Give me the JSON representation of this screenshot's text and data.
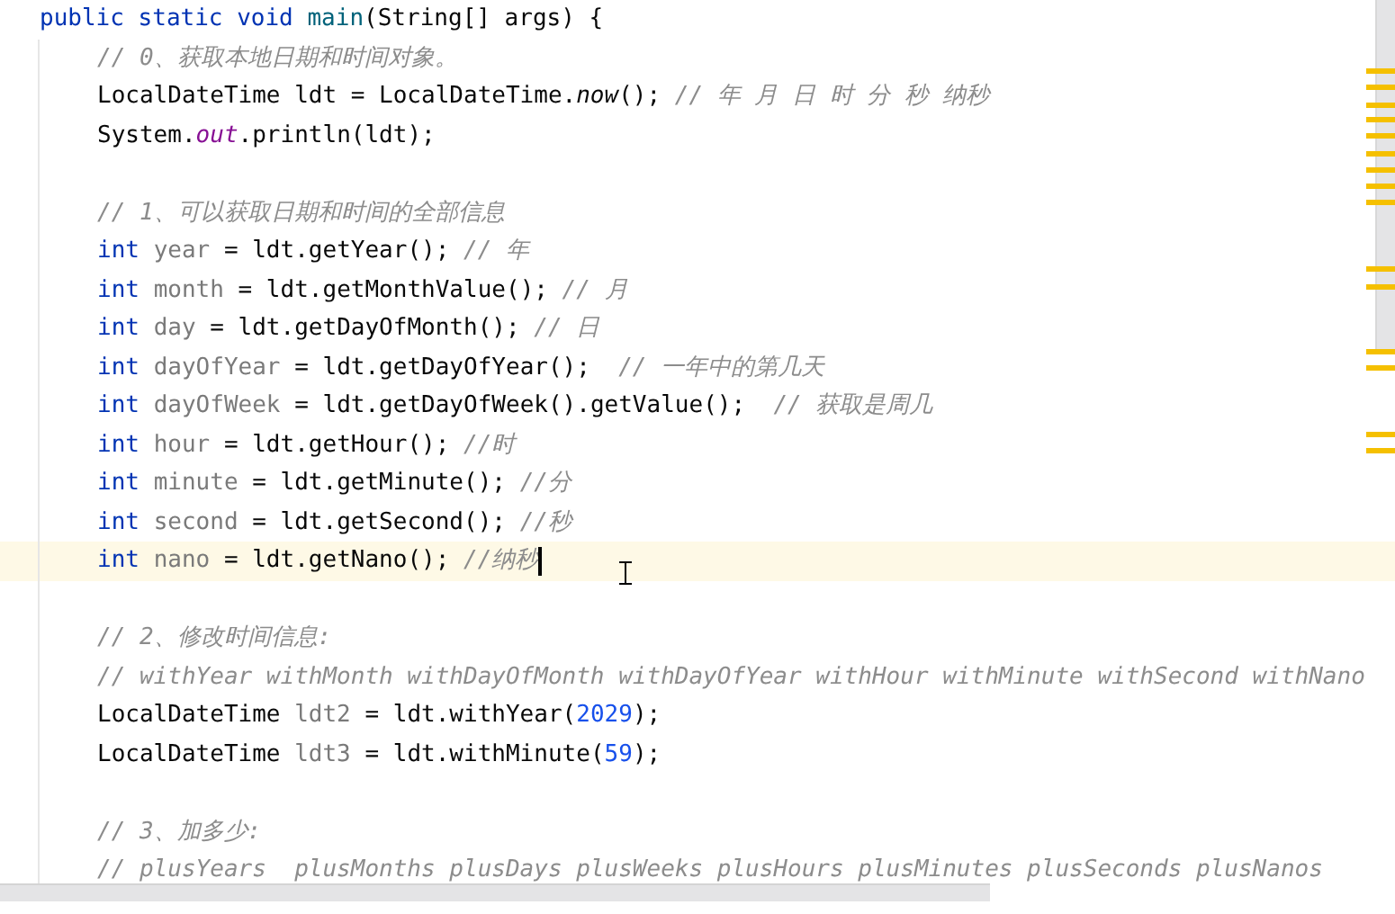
{
  "editor": {
    "header": [
      {
        "kind": "kw",
        "text": "public static void "
      },
      {
        "kind": "fn",
        "text": "main"
      },
      {
        "kind": "plain",
        "text": "(String[] args) {"
      }
    ],
    "body": [
      {
        "kind": "code",
        "current": false,
        "tokens": [
          {
            "kind": "comment",
            "text": "// 0、获取本地日期和时间对象。"
          }
        ]
      },
      {
        "kind": "code",
        "current": false,
        "tokens": [
          {
            "kind": "plain",
            "text": "LocalDateTime ldt = LocalDateTime."
          },
          {
            "kind": "static",
            "text": "now"
          },
          {
            "kind": "plain",
            "text": "(); "
          },
          {
            "kind": "comment",
            "text": "// 年 月 日 时 分 秒 纳秒"
          }
        ]
      },
      {
        "kind": "code",
        "current": false,
        "tokens": [
          {
            "kind": "plain",
            "text": "System."
          },
          {
            "kind": "field",
            "text": "out"
          },
          {
            "kind": "plain",
            "text": ".println(ldt);"
          }
        ]
      },
      {
        "kind": "blank",
        "current": false
      },
      {
        "kind": "code",
        "current": false,
        "tokens": [
          {
            "kind": "comment",
            "text": "// 1、可以获取日期和时间的全部信息"
          }
        ]
      },
      {
        "kind": "code",
        "current": false,
        "tokens": [
          {
            "kind": "kw",
            "text": "int "
          },
          {
            "kind": "var",
            "text": "year"
          },
          {
            "kind": "plain",
            "text": " = ldt.getYear(); "
          },
          {
            "kind": "comment",
            "text": "// 年"
          }
        ]
      },
      {
        "kind": "code",
        "current": false,
        "tokens": [
          {
            "kind": "kw",
            "text": "int "
          },
          {
            "kind": "var",
            "text": "month"
          },
          {
            "kind": "plain",
            "text": " = ldt.getMonthValue(); "
          },
          {
            "kind": "comment",
            "text": "// 月"
          }
        ]
      },
      {
        "kind": "code",
        "current": false,
        "tokens": [
          {
            "kind": "kw",
            "text": "int "
          },
          {
            "kind": "var",
            "text": "day"
          },
          {
            "kind": "plain",
            "text": " = ldt.getDayOfMonth(); "
          },
          {
            "kind": "comment",
            "text": "// 日"
          }
        ]
      },
      {
        "kind": "code",
        "current": false,
        "tokens": [
          {
            "kind": "kw",
            "text": "int "
          },
          {
            "kind": "var",
            "text": "dayOfYear"
          },
          {
            "kind": "plain",
            "text": " = ldt.getDayOfYear();  "
          },
          {
            "kind": "comment",
            "text": "// 一年中的第几天"
          }
        ]
      },
      {
        "kind": "code",
        "current": false,
        "tokens": [
          {
            "kind": "kw",
            "text": "int "
          },
          {
            "kind": "var",
            "text": "dayOfWeek"
          },
          {
            "kind": "plain",
            "text": " = ldt.getDayOfWeek().getValue();  "
          },
          {
            "kind": "comment",
            "text": "// 获取是周几"
          }
        ]
      },
      {
        "kind": "code",
        "current": false,
        "tokens": [
          {
            "kind": "kw",
            "text": "int "
          },
          {
            "kind": "var",
            "text": "hour"
          },
          {
            "kind": "plain",
            "text": " = ldt.getHour(); "
          },
          {
            "kind": "comment",
            "text": "//时"
          }
        ]
      },
      {
        "kind": "code",
        "current": false,
        "tokens": [
          {
            "kind": "kw",
            "text": "int "
          },
          {
            "kind": "var",
            "text": "minute"
          },
          {
            "kind": "plain",
            "text": " = ldt.getMinute(); "
          },
          {
            "kind": "comment",
            "text": "//分"
          }
        ]
      },
      {
        "kind": "code",
        "current": false,
        "tokens": [
          {
            "kind": "kw",
            "text": "int "
          },
          {
            "kind": "var",
            "text": "second"
          },
          {
            "kind": "plain",
            "text": " = ldt.getSecond(); "
          },
          {
            "kind": "comment",
            "text": "//秒"
          }
        ]
      },
      {
        "kind": "code",
        "current": true,
        "tokens": [
          {
            "kind": "kw",
            "text": "int "
          },
          {
            "kind": "var",
            "text": "nano"
          },
          {
            "kind": "plain",
            "text": " = ldt.getNano(); "
          },
          {
            "kind": "comment",
            "text": "//纳秒"
          }
        ]
      },
      {
        "kind": "blank",
        "current": false
      },
      {
        "kind": "code",
        "current": false,
        "tokens": [
          {
            "kind": "comment",
            "text": "// 2、修改时间信息:"
          }
        ]
      },
      {
        "kind": "code",
        "current": false,
        "tokens": [
          {
            "kind": "comment",
            "text": "// withYear withMonth withDayOfMonth withDayOfYear withHour withMinute withSecond withNano"
          }
        ]
      },
      {
        "kind": "code",
        "current": false,
        "tokens": [
          {
            "kind": "plain",
            "text": "LocalDateTime "
          },
          {
            "kind": "var",
            "text": "ldt2"
          },
          {
            "kind": "plain",
            "text": " = ldt.withYear("
          },
          {
            "kind": "num",
            "text": "2029"
          },
          {
            "kind": "plain",
            "text": ");"
          }
        ]
      },
      {
        "kind": "code",
        "current": false,
        "tokens": [
          {
            "kind": "plain",
            "text": "LocalDateTime "
          },
          {
            "kind": "var",
            "text": "ldt3"
          },
          {
            "kind": "plain",
            "text": " = ldt.withMinute("
          },
          {
            "kind": "num",
            "text": "59"
          },
          {
            "kind": "plain",
            "text": ");"
          }
        ]
      },
      {
        "kind": "blank",
        "current": false
      },
      {
        "kind": "code",
        "current": false,
        "tokens": [
          {
            "kind": "comment",
            "text": "// 3、加多少:"
          }
        ]
      },
      {
        "kind": "code",
        "current": false,
        "tokens": [
          {
            "kind": "comment",
            "text": "// plusYears  plusMonths plusDays plusWeeks plusHours plusMinutes plusSeconds plusNanos"
          }
        ]
      }
    ]
  }
}
